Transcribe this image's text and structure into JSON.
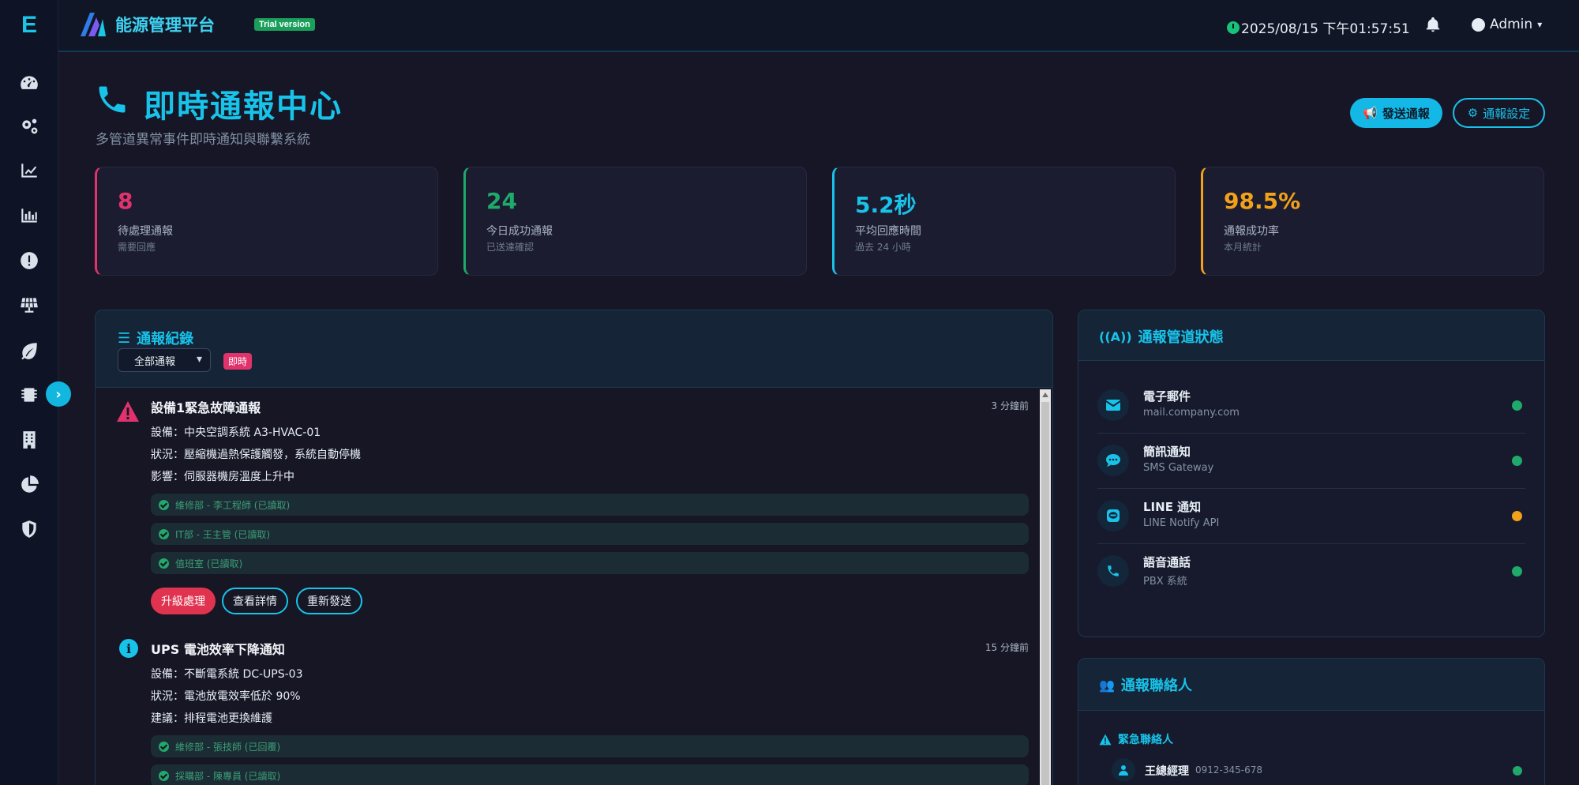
{
  "sidebar": {
    "logo": "E",
    "icons": [
      "dashboard-icon",
      "cogs-icon",
      "line-chart-icon",
      "bar-chart-icon",
      "alert-icon",
      "solar-panel-icon",
      "leaf-icon",
      "chip-icon",
      "building-icon",
      "pie-chart-icon",
      "shield-icon"
    ]
  },
  "topbar": {
    "app_name": "能源管理平台",
    "trial_badge": "Trial version",
    "datetime": "2025/08/15 下午01:57:51",
    "user": "Admin"
  },
  "header": {
    "title": "即時通報中心",
    "subtitle": "多管道異常事件即時通知與聯繫系統",
    "send_button": "發送通報",
    "settings_button": "通報設定"
  },
  "stats": [
    {
      "value": "8",
      "label": "待處理通報",
      "note": "需要回應",
      "color": "#e0336c"
    },
    {
      "value": "24",
      "label": "今日成功通報",
      "note": "已送達確認",
      "color": "#1faa6b"
    },
    {
      "value": "5.2秒",
      "label": "平均回應時間",
      "note": "過去 24 小時",
      "color": "#18c3ea"
    },
    {
      "value": "98.5%",
      "label": "通報成功率",
      "note": "本月統計",
      "color": "#f2a11b"
    }
  ],
  "records": {
    "title": "通報紀錄",
    "filter_value": "全部通報",
    "filter_badge": "即時",
    "events": [
      {
        "title": "設備1緊急故障通報",
        "time": "3 分鐘前",
        "lines": [
          "設備：中央空調系統 A3-HVAC-01",
          "狀況：壓縮機過熱保護觸發，系統自動停機",
          "影響：伺服器機房溫度上升中"
        ],
        "contacts": [
          "維修部 - 李工程師 (已讀取)",
          "IT部 - 王主管 (已讀取)",
          "值班室 (已讀取)"
        ],
        "actions": [
          "升級處理",
          "查看詳情",
          "重新發送"
        ]
      },
      {
        "title": "UPS 電池效率下降通知",
        "time": "15 分鐘前",
        "lines": [
          "設備：不斷電系統 DC-UPS-03",
          "狀況：電池放電效率低於 90%",
          "建議：排程電池更換維護"
        ],
        "contacts": [
          "維修部 - 張技師 (已回覆)",
          "採購部 - 陳專員 (已讀取)"
        ]
      }
    ]
  },
  "channels": {
    "title": "通報管道狀態",
    "items": [
      {
        "name": "電子郵件",
        "desc": "mail.company.com",
        "icon": "envelope-icon",
        "status": "#1faa6b"
      },
      {
        "name": "簡訊通知",
        "desc": "SMS Gateway",
        "icon": "sms-icon",
        "status": "#1faa6b"
      },
      {
        "name": "LINE 通知",
        "desc": "LINE Notify API",
        "icon": "line-icon",
        "status": "#f2a11b"
      },
      {
        "name": "語音通話",
        "desc": "PBX 系統",
        "icon": "phone-icon",
        "status": "#1faa6b"
      }
    ]
  },
  "contacts_panel": {
    "title": "通報聯絡人",
    "group": "緊急聯絡人",
    "first_contact": {
      "name": "王總經理",
      "phone": "0912-345-678"
    }
  }
}
